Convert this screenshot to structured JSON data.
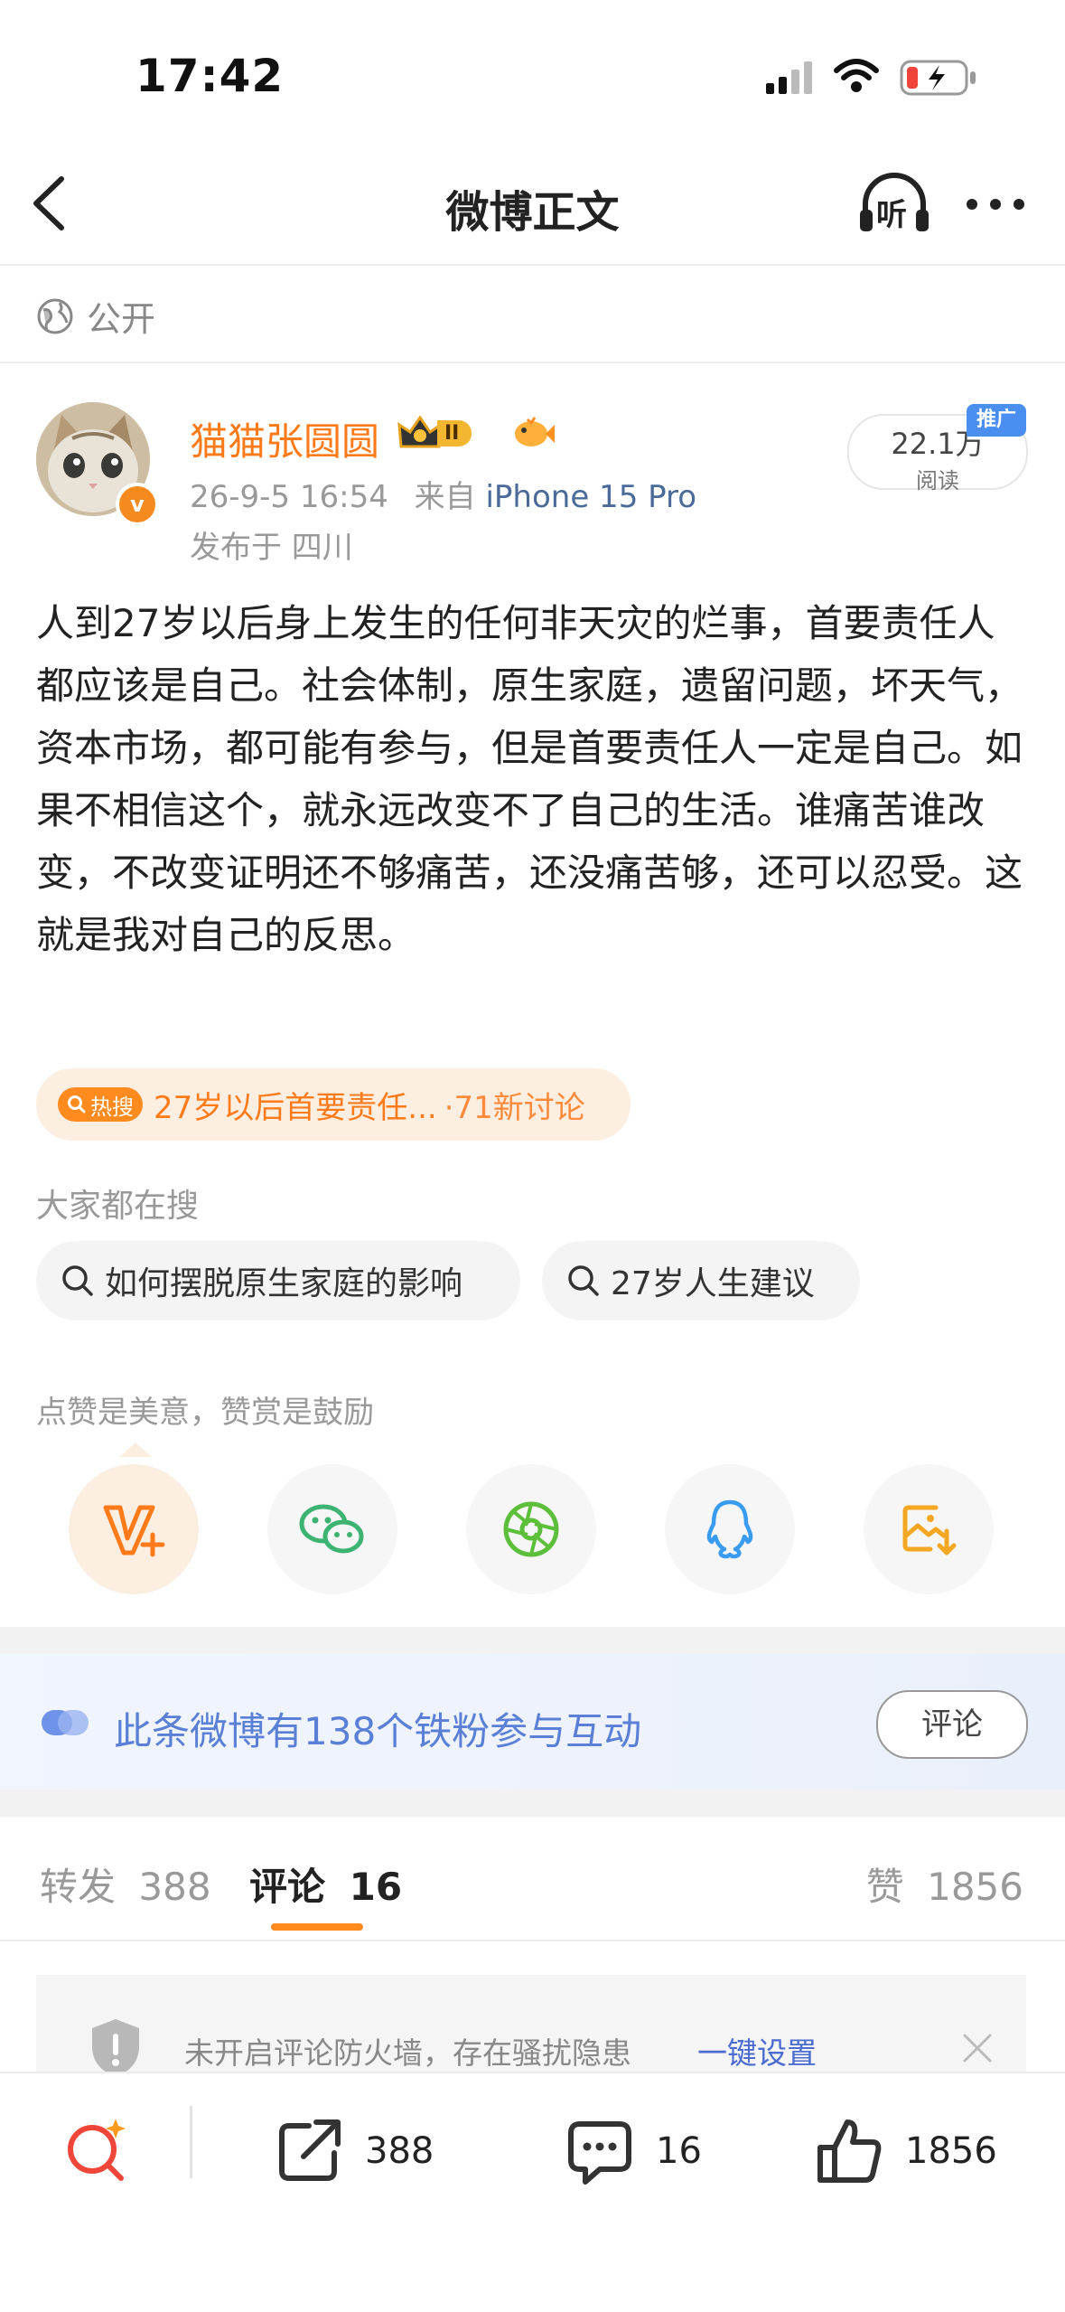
{
  "status_bar": {
    "time": "17:42"
  },
  "nav": {
    "title": "微博正文",
    "listen_label": "听"
  },
  "visibility": {
    "label": "公开"
  },
  "post": {
    "author": "猫猫张圆圆",
    "level_badge": "II",
    "verified": "v",
    "time": "26-9-5 16:54",
    "from_prefix": "来自",
    "device": "iPhone 15 Pro",
    "location": "发布于 四川",
    "reads": "22.1万",
    "reads_label": "阅读",
    "promo_badge": "推广",
    "text": "人到27岁以后身上发生的任何非天灾的烂事，首要责任人都应该是自己。社会体制，原生家庭，遗留问题，坏天气，资本市场，都可能有参与，但是首要责任人一定是自己。如果不相信这个，就永远改变不了自己的生活。谁痛苦谁改变，不改变证明还不够痛苦，还没痛苦够，还可以忍受。这就是我对自己的反思。"
  },
  "trend": {
    "tag": "热搜",
    "topic": "27岁以后首要责任...",
    "count": "·71新讨论"
  },
  "searches": {
    "title": "大家都在搜",
    "items": [
      "如何摆脱原生家庭的影响",
      "27岁人生建议"
    ]
  },
  "praise": {
    "title": "点赞是美意，赞赏是鼓励"
  },
  "share_icons": [
    "v-plus-icon",
    "wechat-icon",
    "moments-icon",
    "qq-icon",
    "save-image-icon"
  ],
  "fans_banner": {
    "text": "此条微博有138个铁粉参与互动",
    "button": "评论"
  },
  "tabs": {
    "repost_label": "转发",
    "repost_count": "388",
    "comment_label": "评论",
    "comment_count": "16",
    "like_label": "赞",
    "like_count": "1856"
  },
  "firewall": {
    "text": "未开启评论防火墙，存在骚扰隐患",
    "link": "一键设置"
  },
  "bottom_bar": {
    "repost": "388",
    "comment": "16",
    "like": "1856"
  },
  "colors": {
    "accent": "#ff7b1a",
    "link": "#4a6b9a",
    "banner": "#5a7fd6"
  }
}
